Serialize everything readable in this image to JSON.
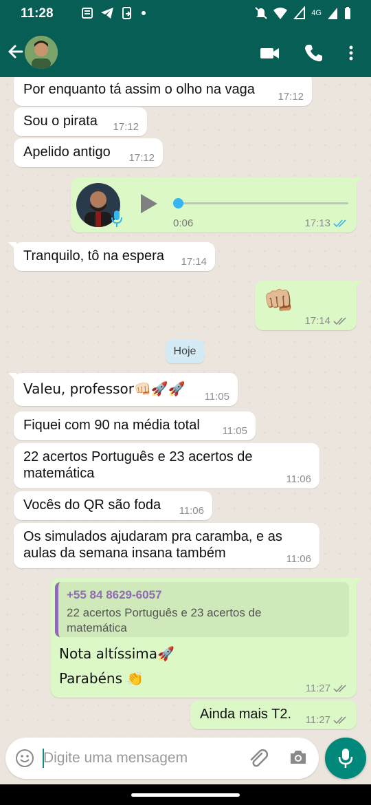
{
  "status_bar": {
    "time": "11:28",
    "network_label": "4G"
  },
  "header": {
    "contact_avatar": "contact-photo",
    "icons": [
      "back-arrow-icon",
      "video-call-icon",
      "voice-call-icon",
      "more-options-icon"
    ]
  },
  "messages": {
    "m1": {
      "text": "Por enquanto tá assim o olho na vaga",
      "time": "17:12"
    },
    "m2": {
      "text": "Sou o pirata",
      "time": "17:12"
    },
    "m3": {
      "text": "Apelido antigo",
      "time": "17:12"
    },
    "voice": {
      "duration": "0:06",
      "time": "17:13",
      "progress": 0.0
    },
    "m4": {
      "text": "Tranquilo, tô na espera",
      "time": "17:14"
    },
    "m5": {
      "emoji": "👊🏼",
      "time": "17:14"
    },
    "date_divider": "Hoje",
    "m6": {
      "text": "Valeu, professor👊🏻🚀🚀",
      "time": "11:05"
    },
    "m7": {
      "text": "Fiquei com 90 na média total",
      "time": "11:05"
    },
    "m8": {
      "line1": "22 acertos Português e 23 acertos de",
      "line2": "matemática",
      "time": "11:06"
    },
    "m9": {
      "text": "Vocês do QR são foda",
      "time": "11:06"
    },
    "m10": {
      "line1": "Os simulados ajudaram pra caramba, e as",
      "line2": "aulas da semana insana também",
      "time": "11:06"
    },
    "m11": {
      "quote_name": "+55 84 8629-6057",
      "quote_line1": "22 acertos Português e 23 acertos de",
      "quote_line2": "matemática",
      "line1": "Nota altíssima🚀",
      "line2": "Parabéns 👏",
      "time": "11:27"
    },
    "m12": {
      "text": "Ainda mais T2.",
      "time": "11:27"
    }
  },
  "composer": {
    "placeholder": "Digite uma mensagem"
  },
  "colors": {
    "header": "#075e54",
    "outgoing": "#dcf8c6",
    "incoming": "#ffffff",
    "read_tick": "#34b7f1",
    "sent_tick": "#8c8c8c",
    "fab": "#00897b"
  }
}
